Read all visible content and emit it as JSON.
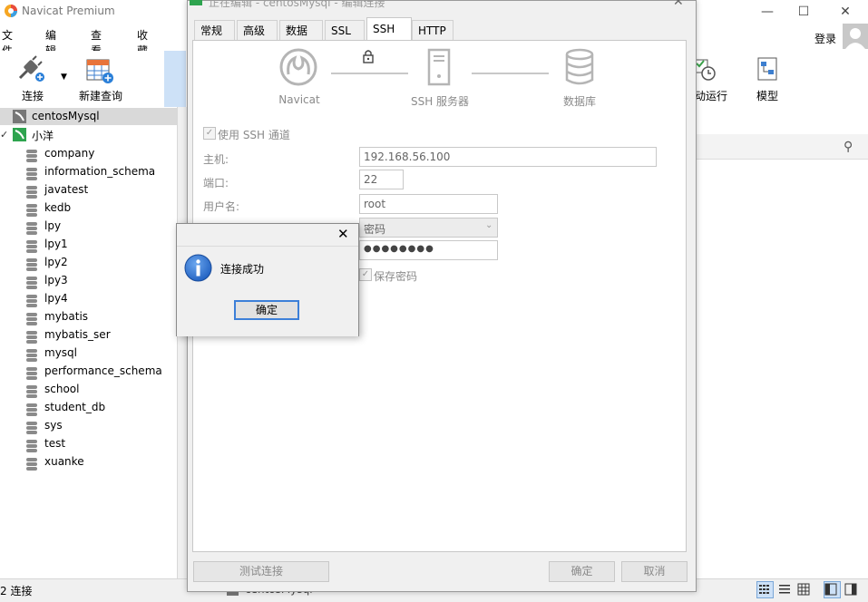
{
  "app": {
    "title": "Navicat Premium",
    "login": "登录"
  },
  "menu": {
    "items": [
      "文件",
      "编辑",
      "查看",
      "收藏夹"
    ]
  },
  "toolbar": {
    "connect": "连接",
    "new_query": "新建查询",
    "auto_run": "动运行",
    "model": "模型"
  },
  "sidebar": {
    "connections": [
      {
        "name": "centosMysql"
      },
      {
        "name": "小洋"
      }
    ],
    "databases": [
      "company",
      "information_schema",
      "javatest",
      "kedb",
      "lpy",
      "lpy1",
      "lpy2",
      "lpy3",
      "lpy4",
      "mybatis",
      "mybatis_ser",
      "mysql",
      "performance_schema",
      "school",
      "student_db",
      "sys",
      "test",
      "xuanke"
    ]
  },
  "statusbar": {
    "text": "2 连接",
    "connection": "centosMysql"
  },
  "edit_window": {
    "title": "正在编辑 - centosMysql - 编辑连接",
    "tabs": [
      "常规",
      "高级",
      "数据库",
      "SSL",
      "SSH",
      "HTTP"
    ],
    "active_tab": "SSH",
    "diagram": {
      "left": "Navicat",
      "middle": "SSH 服务器",
      "right": "数据库"
    },
    "use_ssh_label": "使用 SSH 通道",
    "host_label": "主机:",
    "host_value": "192.168.56.100",
    "port_label": "端口:",
    "port_value": "22",
    "user_label": "用户名:",
    "user_value": "root",
    "auth_value": "密码",
    "password_value": "●●●●●●●●",
    "save_password_label": "保存密码",
    "test_button": "测试连接",
    "ok_button": "确定",
    "cancel_button": "取消"
  },
  "message_box": {
    "text": "连接成功",
    "ok": "确定"
  },
  "colors": {
    "accent": "#3c7fd8",
    "selection": "#cde1f7",
    "info_icon": "#1f5fc0"
  }
}
